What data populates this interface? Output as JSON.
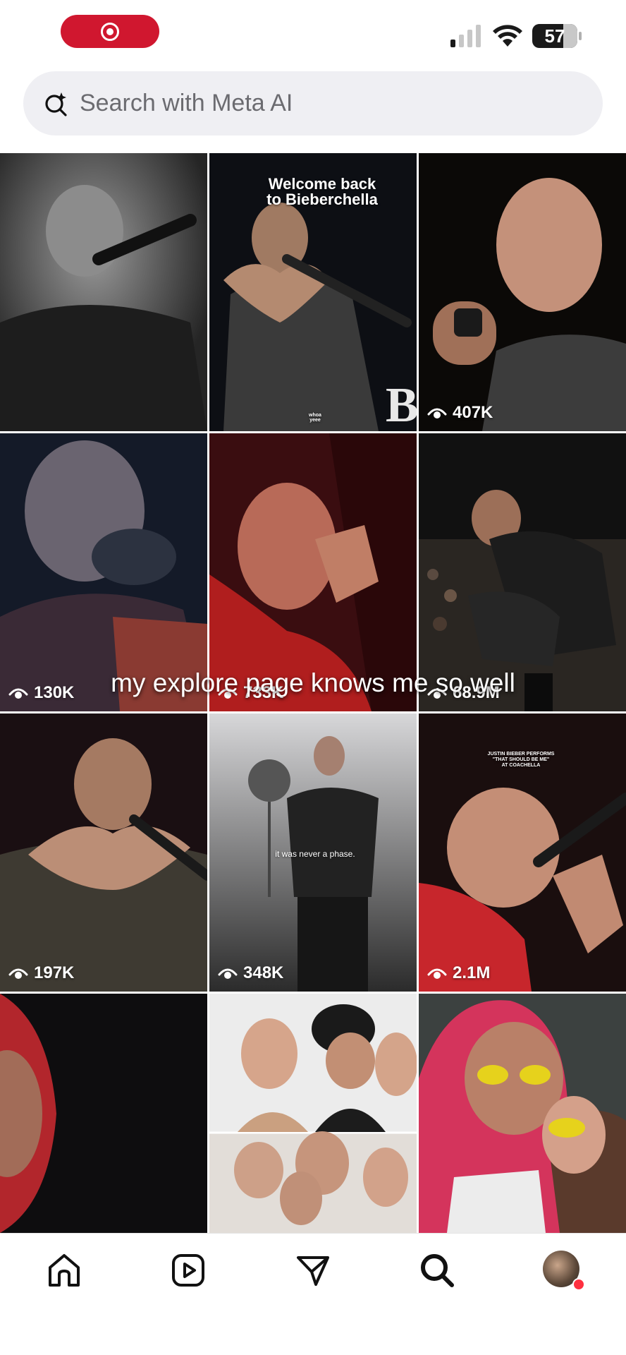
{
  "status_bar": {
    "battery": "57"
  },
  "search": {
    "placeholder": "Search with Meta AI"
  },
  "overlay_caption": "my explore page knows me so well",
  "tiles": [
    {
      "views": "",
      "caption_line1": "",
      "caption_line2": ""
    },
    {
      "views": "",
      "caption_line1": "Welcome back",
      "caption_line2": "to      Bieberchella",
      "watermark": "whoa yeee"
    },
    {
      "views": "407K"
    },
    {
      "views": "130K"
    },
    {
      "views": "733K"
    },
    {
      "views": "68.9M"
    },
    {
      "views": "197K"
    },
    {
      "views": "348K",
      "shirt_text": "it was never a phase."
    },
    {
      "views": "2.1M",
      "caption_line1": "JUSTIN BIEBER PERFORMS",
      "caption_line2": "\"THAT SHOULD BE ME\"",
      "caption_line3": "AT COACHELLA"
    },
    {
      "views": ""
    },
    {
      "views": ""
    },
    {
      "views": ""
    }
  ],
  "nav": {
    "items": [
      "home-icon",
      "reels-icon",
      "messages-icon",
      "search-icon",
      "profile-avatar"
    ]
  }
}
